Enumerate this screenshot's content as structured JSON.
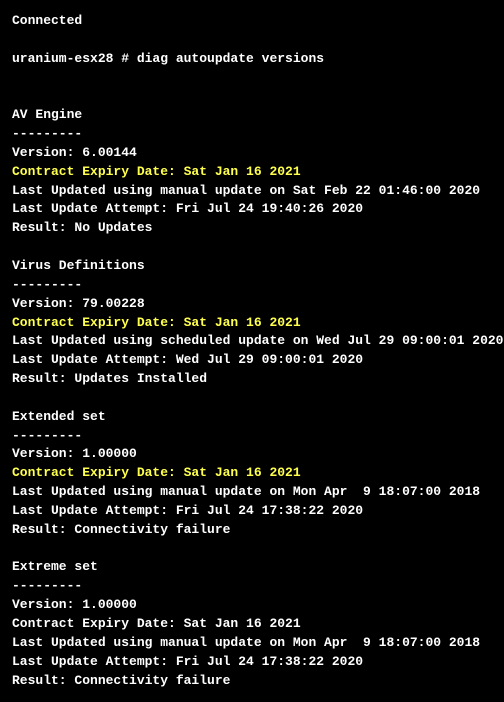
{
  "header": {
    "status": "Connected",
    "prompt": "uranium-esx28 # diag autoupdate versions"
  },
  "sections": [
    {
      "title": "AV Engine",
      "divider": "---------",
      "version": "Version: 6.00144",
      "expiry": "Contract Expiry Date: Sat Jan 16 2021",
      "expiry_highlight": true,
      "updated": "Last Updated using manual update on Sat Feb 22 01:46:00 2020",
      "attempt": "Last Update Attempt: Fri Jul 24 19:40:26 2020",
      "result": "Result: No Updates"
    },
    {
      "title": "Virus Definitions",
      "divider": "---------",
      "version": "Version: 79.00228",
      "expiry": "Contract Expiry Date: Sat Jan 16 2021",
      "expiry_highlight": true,
      "updated": "Last Updated using scheduled update on Wed Jul 29 09:00:01 2020",
      "attempt": "Last Update Attempt: Wed Jul 29 09:00:01 2020",
      "result": "Result: Updates Installed"
    },
    {
      "title": "Extended set",
      "divider": "---------",
      "version": "Version: 1.00000",
      "expiry": "Contract Expiry Date: Sat Jan 16 2021",
      "expiry_highlight": true,
      "updated": "Last Updated using manual update on Mon Apr  9 18:07:00 2018",
      "attempt": "Last Update Attempt: Fri Jul 24 17:38:22 2020",
      "result": "Result: Connectivity failure"
    },
    {
      "title": "Extreme set",
      "divider": "---------",
      "version": "Version: 1.00000",
      "expiry": "Contract Expiry Date: Sat Jan 16 2021",
      "expiry_highlight": false,
      "updated": "Last Updated using manual update on Mon Apr  9 18:07:00 2018",
      "attempt": "Last Update Attempt: Fri Jul 24 17:38:22 2020",
      "result": "Result: Connectivity failure"
    }
  ]
}
